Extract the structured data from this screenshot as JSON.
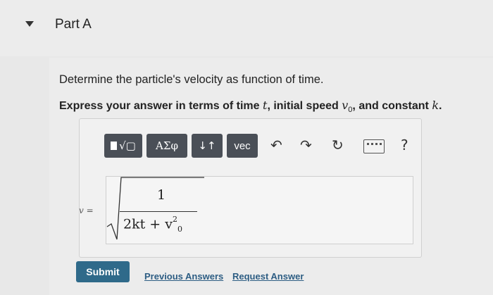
{
  "part": {
    "title": "Part A"
  },
  "question": {
    "prompt": "Determine the particle's velocity as function of time.",
    "instruction_prefix": "Express your answer in terms of time ",
    "var_t": "t",
    "instruction_mid1": ", initial speed ",
    "var_v0": "v",
    "var_v0_sub": "0",
    "instruction_mid2": ", and constant ",
    "var_k": "k",
    "instruction_end": "."
  },
  "toolbar": {
    "templates_icon": "templates-icon",
    "greek_label": "ΑΣφ",
    "arrows_label": "↓↑",
    "vec_label": "vec",
    "undo_glyph": "↶",
    "redo_glyph": "↷",
    "reset_glyph": "↻",
    "help_label": "?"
  },
  "answer": {
    "variable_label": "v =",
    "numerator": "1",
    "denominator_main": "2kt + v",
    "denominator_sup": "2",
    "denominator_sub": "0"
  },
  "actions": {
    "submit_label": "Submit",
    "previous_answers_label": "Previous Answers",
    "request_answer_label": "Request Answer"
  },
  "colors": {
    "toolbar_button": "#4a4f57",
    "submit_button": "#2f6a8a",
    "link": "#2d5d83"
  }
}
